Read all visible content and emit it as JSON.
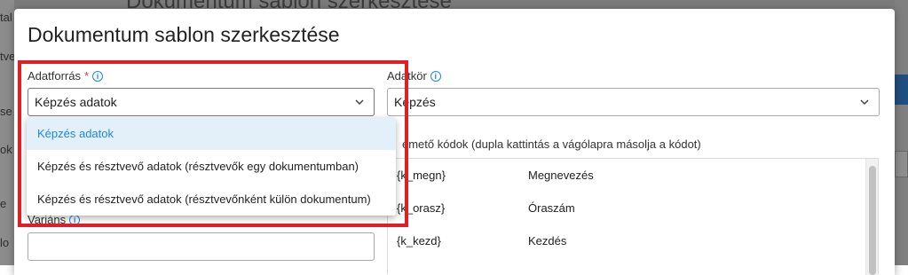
{
  "background": {
    "title": "Dokumentum sablon szerkesztése",
    "sidebar_fragments": [
      "tal",
      "tve",
      "se",
      "ok",
      "e",
      "lo"
    ]
  },
  "dialog": {
    "title": "Dokumentum sablon szerkesztése",
    "adatforras": {
      "label": "Adatforrás",
      "required_mark": "*",
      "value": "Képzés adatok"
    },
    "adatkor": {
      "label": "Adatkör",
      "value": "Képzés"
    },
    "varians": {
      "label": "Variáns",
      "value": ""
    },
    "codes": {
      "title": "Használható helyettesítő kódok (dupla kattintás a vágólapra másolja a kódot)",
      "visible_title": "émető kódok (dupla kattintás a vágólapra másolja a kódot)",
      "rows": [
        {
          "key": "{k_megn}",
          "label": "Megnevezés"
        },
        {
          "key": "{k_orasz}",
          "label": "Óraszám"
        },
        {
          "key": "{k_kezd}",
          "label": "Kezdés"
        }
      ]
    }
  },
  "dropdown": {
    "options": [
      {
        "label": "Képzés adatok",
        "selected": true
      },
      {
        "label": "Képzés és résztvevő adatok (résztvevők egy dokumentumban)",
        "selected": false
      },
      {
        "label": "Képzés és résztvevő adatok (résztvevőnként külön dokumentum)",
        "selected": false
      }
    ]
  },
  "colors": {
    "accent": "#1e88e5",
    "required": "#e53935",
    "highlight": "#e01e25"
  },
  "icons": [
    "info-icon",
    "chevron-down-icon"
  ]
}
